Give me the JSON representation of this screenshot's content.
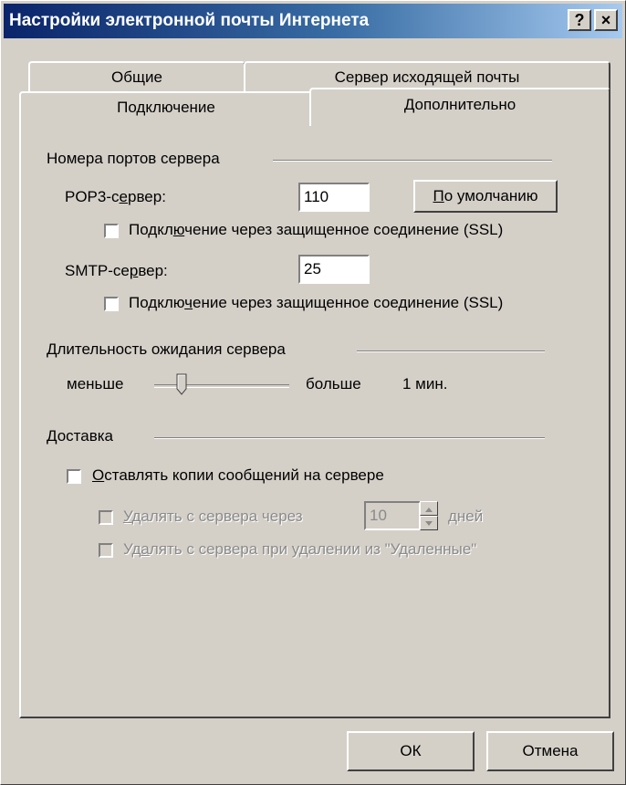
{
  "window": {
    "title": "Настройки электронной почты Интернета",
    "help_label": "?",
    "close_label": "×"
  },
  "tabs": {
    "general": "Общие",
    "outgoing": "Сервер исходящей почты",
    "connection": "Подключение",
    "advanced": "Дополнительно"
  },
  "ports": {
    "group_title": "Номера портов сервера",
    "pop3": {
      "prefix": "POP3-с",
      "accel": "е",
      "suffix": "рвер:",
      "value": "110"
    },
    "default_button": {
      "accel": "П",
      "rest": "о умолчанию"
    },
    "ssl1": {
      "prefix": "Подкл",
      "accel": "ю",
      "suffix": "чение через защищенное соединение (SSL)",
      "checked": false
    },
    "smtp": {
      "prefix": "SMTP-се",
      "accel": "р",
      "suffix": "вер:",
      "value": "25"
    },
    "ssl2": {
      "prefix": "Подклю",
      "accel": "ч",
      "suffix": "ение через защищенное соединение (SSL)",
      "checked": false
    }
  },
  "timeout": {
    "group_title": "Длительность ожидания сервера",
    "accel": "Д",
    "rest": "лительность ожидания сервера",
    "less": "меньше",
    "more": "больше",
    "value": "1 мин.",
    "slider_level": 0.18
  },
  "delivery": {
    "group_title": "Доставка",
    "leave_copies": {
      "accel": "О",
      "rest": "ставлять копии сообщений на сервере",
      "checked": false
    },
    "remove_after": {
      "accel": "У",
      "rest": "далять с сервера через",
      "days_value": "10",
      "days_label": "дней",
      "checked": false,
      "enabled": false
    },
    "remove_deleted": {
      "prefix": "Уд",
      "accel": "а",
      "suffix": "лять с сервера при удалении из \"Удаленные\"",
      "checked": false,
      "enabled": false
    }
  },
  "buttons": {
    "ok": "ОК",
    "cancel": "Отмена"
  }
}
